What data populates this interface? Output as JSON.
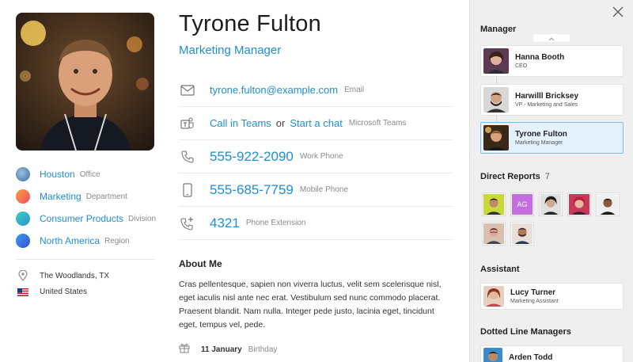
{
  "profile": {
    "name": "Tyrone Fulton",
    "title": "Marketing Manager"
  },
  "facts": [
    {
      "value": "Houston",
      "tag": "Office",
      "color": "#5b7fb0",
      "icon": "office-photo-icon"
    },
    {
      "value": "Marketing",
      "tag": "Department",
      "color": "#f47c3c",
      "icon": "department-dot-icon"
    },
    {
      "value": "Consumer Products",
      "tag": "Division",
      "color": "#34b7c6",
      "icon": "division-dot-icon"
    },
    {
      "value": "North America",
      "tag": "Region",
      "color": "#2d7fe0",
      "icon": "region-dot-icon"
    }
  ],
  "location": {
    "city": "The Woodlands, TX",
    "country": "United States"
  },
  "contacts": {
    "email": {
      "value": "tyrone.fulton@example.com",
      "tag": "Email",
      "icon": "mail-icon"
    },
    "teams": {
      "call": "Call in Teams",
      "or": "or",
      "chat": "Start a chat",
      "tag": "Microsoft Teams",
      "icon": "teams-icon"
    },
    "work_phone": {
      "value": "555-922-2090",
      "tag": "Work Phone",
      "icon": "phone-icon"
    },
    "mobile_phone": {
      "value": "555-685-7759",
      "tag": "Mobile Phone",
      "icon": "mobile-icon"
    },
    "extension": {
      "value": "4321",
      "tag": "Phone Extension",
      "icon": "phone-extension-icon"
    }
  },
  "about": {
    "heading": "About Me",
    "text": "Cras pellentesque, sapien non viverra luctus, velit sem scelerisque nisl, eget iaculis nisl ante nec erat. Vestibulum sed nunc commodo placerat. Praesent blandit. Nam nulla. Integer pede justo, lacinia eget, tincidunt eget, tempus vel, pede."
  },
  "birthday": {
    "date": "11 January",
    "tag": "Birthday",
    "icon": "gift-icon"
  },
  "panel": {
    "manager_heading": "Manager",
    "chain": [
      {
        "name": "Hanna Booth",
        "title": "CEO"
      },
      {
        "name": "Harwilll Bricksey",
        "title": "VP - Marketing and Sales"
      },
      {
        "name": "Tyrone Fulton",
        "title": "Marketing Manager"
      }
    ],
    "direct_reports_heading": "Direct Reports",
    "direct_reports_count": "7",
    "direct_reports_initials": "AG",
    "assistant_heading": "Assistant",
    "assistant": {
      "name": "Lucy Turner",
      "title": "Marketing Assistant"
    },
    "dotted_heading": "Dotted Line Managers",
    "dotted": {
      "name": "Arden Todd"
    }
  },
  "colors": {
    "accent": "#1f8fd4",
    "panel_bg": "#efefef",
    "selected_bg": "#e3f2fc"
  }
}
